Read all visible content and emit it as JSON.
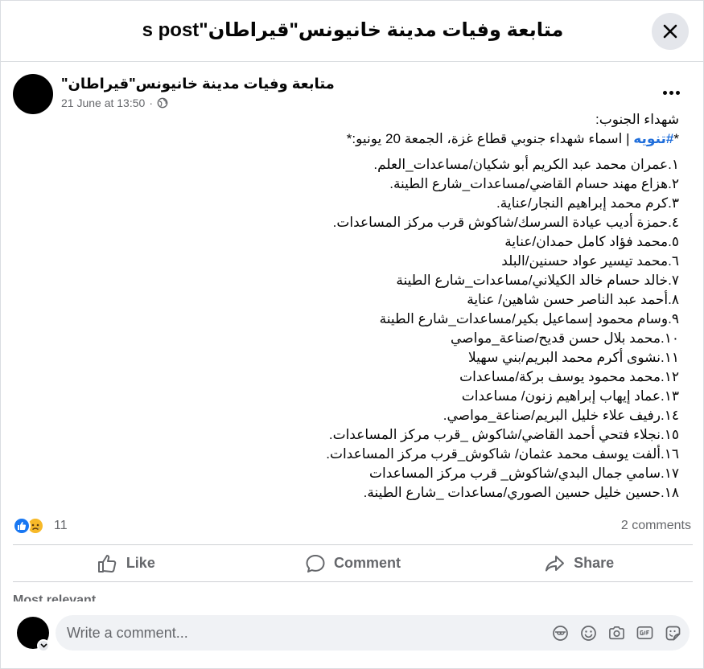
{
  "header": {
    "title": "s post\"متابعة وفيات مدينة خانيونس\"قيراطان"
  },
  "post": {
    "author": "\"متابعة وفيات مدينة خانيونس\"قيراطان",
    "date": "21 June at 13:50",
    "separator": "·",
    "heading": "شهداء الجنوب:",
    "intro_prefix": "*",
    "intro_hashtag": "#تنويه",
    "intro_text": " | اسماء شهداء جنوبي قطاع غزة، الجمعة 20 يونيو:*",
    "lines": [
      "١.عمران محمد عبد الكريم أبو شكيان/مساعدات_العلم.",
      "٢.هزاع مهند حسام القاضي/مساعدات_شارع الطينة.",
      "٣.كرم محمد إبراهيم النجار/عناية.",
      "٤.حمزة أديب عيادة السرسك/شاكوش قرب مركز المساعدات.",
      "٥.محمد فؤاد كامل حمدان/عناية",
      "٦.محمد تيسير عواد حسنين/البلد",
      "٧.خالد حسام خالد الكيلاني/مساعدات_شارع الطينة",
      "٨.أحمد عبد الناصر حسن شاهين/ عناية",
      "٩.وسام محمود إسماعيل بكير/مساعدات_شارع الطينة",
      "١٠.محمد بلال حسن قديح/صناعة_مواصي",
      "١١.نشوى أكرم محمد البريم/بني سهيلا",
      "١٢.محمد محمود يوسف بركة/مساعدات",
      "١٣.عماد إيهاب إبراهيم زنون/ مساعدات",
      "١٤.رفيف علاء خليل البريم/صناعة_مواصي.",
      "١٥.نجلاء فتحي أحمد القاضي/شاكوش _قرب مركز المساعدات.",
      "١٦.ألفت يوسف محمد عثمان/ شاكوش_قرب مركز المساعدات.",
      "١٧.سامي جمال البدي/شاكوش_ قرب مركز المساعدات",
      "١٨.حسين خليل حسين الصوري/مساعدات _شارع الطينة."
    ]
  },
  "reactions": {
    "count": "11",
    "types": [
      "like-icon",
      "sad-icon"
    ],
    "like_color": "#1877f2",
    "sad_color": "#f7b928"
  },
  "comments_count": "2 comments",
  "actions": {
    "like": "Like",
    "comment": "Comment",
    "share": "Share"
  },
  "peek_label": "Most relevant",
  "composer": {
    "placeholder": "Write a comment..."
  },
  "colors": {
    "link": "#216fdb",
    "muted": "#65676b",
    "composer_bg": "#f0f2f5"
  }
}
